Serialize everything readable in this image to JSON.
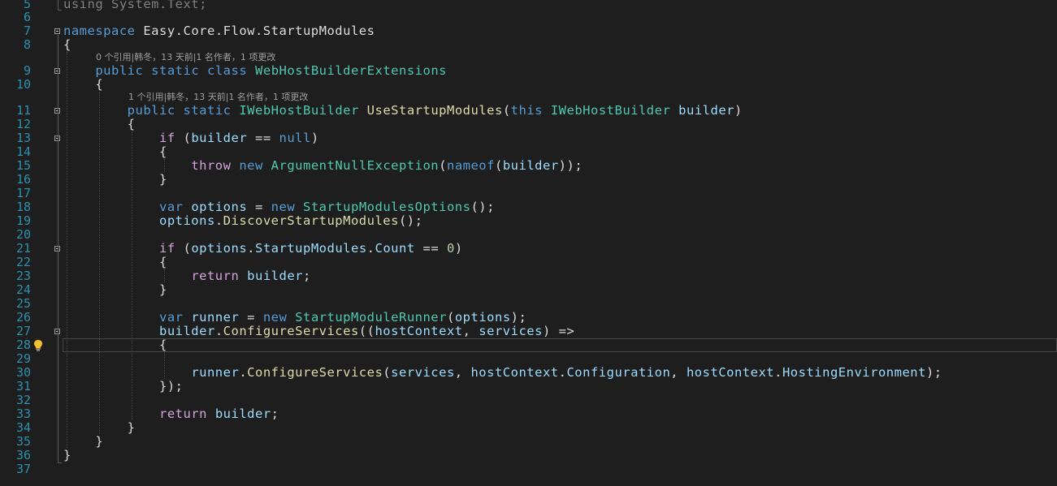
{
  "editor": {
    "line_numbers": [
      "5",
      "6",
      "7",
      "8",
      "9",
      "10",
      "11",
      "12",
      "13",
      "14",
      "15",
      "16",
      "17",
      "18",
      "19",
      "20",
      "21",
      "22",
      "23",
      "24",
      "25",
      "26",
      "27",
      "28",
      "29",
      "30",
      "31",
      "32",
      "33",
      "34",
      "35",
      "36",
      "37"
    ],
    "codelens": {
      "class_refs": "0 个引用|韩冬，13 天前|1 名作者，1 项更改",
      "method_refs": "1 个引用|韩冬，13 天前|1 名作者，1 项更改"
    },
    "code": {
      "l5": [
        {
          "t": "using System.Text;",
          "c": "dim"
        }
      ],
      "l7": [
        {
          "t": "namespace",
          "c": "kw"
        },
        {
          "t": " Easy.Core.Flow.StartupModules",
          "c": "pl"
        }
      ],
      "l8": [
        {
          "t": "{",
          "c": "pl"
        }
      ],
      "l9": [
        {
          "t": "    ",
          "c": "pl"
        },
        {
          "t": "public",
          "c": "kw"
        },
        {
          "t": " ",
          "c": "pl"
        },
        {
          "t": "static",
          "c": "kw"
        },
        {
          "t": " ",
          "c": "pl"
        },
        {
          "t": "class",
          "c": "kw"
        },
        {
          "t": " ",
          "c": "pl"
        },
        {
          "t": "WebHostBuilderExtensions",
          "c": "ty"
        }
      ],
      "l10": [
        {
          "t": "    {",
          "c": "pl"
        }
      ],
      "l11": [
        {
          "t": "        ",
          "c": "pl"
        },
        {
          "t": "public",
          "c": "kw"
        },
        {
          "t": " ",
          "c": "pl"
        },
        {
          "t": "static",
          "c": "kw"
        },
        {
          "t": " ",
          "c": "pl"
        },
        {
          "t": "IWebHostBuilder",
          "c": "ty"
        },
        {
          "t": " ",
          "c": "pl"
        },
        {
          "t": "UseStartupModules",
          "c": "fn"
        },
        {
          "t": "(",
          "c": "pl"
        },
        {
          "t": "this",
          "c": "kw"
        },
        {
          "t": " ",
          "c": "pl"
        },
        {
          "t": "IWebHostBuilder",
          "c": "ty"
        },
        {
          "t": " ",
          "c": "pl"
        },
        {
          "t": "builder",
          "c": "id"
        },
        {
          "t": ")",
          "c": "pl"
        }
      ],
      "l12": [
        {
          "t": "        {",
          "c": "pl"
        }
      ],
      "l13": [
        {
          "t": "            ",
          "c": "pl"
        },
        {
          "t": "if",
          "c": "ctl"
        },
        {
          "t": " (",
          "c": "pl"
        },
        {
          "t": "builder",
          "c": "id"
        },
        {
          "t": " == ",
          "c": "pl"
        },
        {
          "t": "null",
          "c": "kw"
        },
        {
          "t": ")",
          "c": "pl"
        }
      ],
      "l14": [
        {
          "t": "            {",
          "c": "pl"
        }
      ],
      "l15": [
        {
          "t": "                ",
          "c": "pl"
        },
        {
          "t": "throw",
          "c": "ctl"
        },
        {
          "t": " ",
          "c": "pl"
        },
        {
          "t": "new",
          "c": "kw"
        },
        {
          "t": " ",
          "c": "pl"
        },
        {
          "t": "ArgumentNullException",
          "c": "ty"
        },
        {
          "t": "(",
          "c": "pl"
        },
        {
          "t": "nameof",
          "c": "kw"
        },
        {
          "t": "(",
          "c": "pl"
        },
        {
          "t": "builder",
          "c": "id"
        },
        {
          "t": "));",
          "c": "pl"
        }
      ],
      "l16": [
        {
          "t": "            }",
          "c": "pl"
        }
      ],
      "l18": [
        {
          "t": "            ",
          "c": "pl"
        },
        {
          "t": "var",
          "c": "kw"
        },
        {
          "t": " ",
          "c": "pl"
        },
        {
          "t": "options",
          "c": "id"
        },
        {
          "t": " = ",
          "c": "pl"
        },
        {
          "t": "new",
          "c": "kw"
        },
        {
          "t": " ",
          "c": "pl"
        },
        {
          "t": "StartupModulesOptions",
          "c": "ty"
        },
        {
          "t": "();",
          "c": "pl"
        }
      ],
      "l19": [
        {
          "t": "            ",
          "c": "pl"
        },
        {
          "t": "options",
          "c": "id"
        },
        {
          "t": ".",
          "c": "pl"
        },
        {
          "t": "DiscoverStartupModules",
          "c": "fn"
        },
        {
          "t": "();",
          "c": "pl"
        }
      ],
      "l21": [
        {
          "t": "            ",
          "c": "pl"
        },
        {
          "t": "if",
          "c": "ctl"
        },
        {
          "t": " (",
          "c": "pl"
        },
        {
          "t": "options",
          "c": "id"
        },
        {
          "t": ".",
          "c": "pl"
        },
        {
          "t": "StartupModules",
          "c": "id"
        },
        {
          "t": ".",
          "c": "pl"
        },
        {
          "t": "Count",
          "c": "id"
        },
        {
          "t": " == ",
          "c": "pl"
        },
        {
          "t": "0",
          "c": "num"
        },
        {
          "t": ")",
          "c": "pl"
        }
      ],
      "l22": [
        {
          "t": "            {",
          "c": "pl"
        }
      ],
      "l23": [
        {
          "t": "                ",
          "c": "pl"
        },
        {
          "t": "return",
          "c": "ctl"
        },
        {
          "t": " ",
          "c": "pl"
        },
        {
          "t": "builder",
          "c": "id"
        },
        {
          "t": ";",
          "c": "pl"
        }
      ],
      "l24": [
        {
          "t": "            }",
          "c": "pl"
        }
      ],
      "l26": [
        {
          "t": "            ",
          "c": "pl"
        },
        {
          "t": "var",
          "c": "kw"
        },
        {
          "t": " ",
          "c": "pl"
        },
        {
          "t": "runner",
          "c": "id"
        },
        {
          "t": " = ",
          "c": "pl"
        },
        {
          "t": "new",
          "c": "kw"
        },
        {
          "t": " ",
          "c": "pl"
        },
        {
          "t": "StartupModuleRunner",
          "c": "ty"
        },
        {
          "t": "(",
          "c": "pl"
        },
        {
          "t": "options",
          "c": "id"
        },
        {
          "t": ");",
          "c": "pl"
        }
      ],
      "l27": [
        {
          "t": "            ",
          "c": "pl"
        },
        {
          "t": "builder",
          "c": "id"
        },
        {
          "t": ".",
          "c": "pl"
        },
        {
          "t": "ConfigureServices",
          "c": "fn"
        },
        {
          "t": "((",
          "c": "pl"
        },
        {
          "t": "hostContext",
          "c": "id"
        },
        {
          "t": ", ",
          "c": "pl"
        },
        {
          "t": "services",
          "c": "id"
        },
        {
          "t": ") =>",
          "c": "pl"
        }
      ],
      "l28": [
        {
          "t": "            {",
          "c": "pl"
        }
      ],
      "l30": [
        {
          "t": "                ",
          "c": "pl"
        },
        {
          "t": "runner",
          "c": "id"
        },
        {
          "t": ".",
          "c": "pl"
        },
        {
          "t": "ConfigureServices",
          "c": "fn"
        },
        {
          "t": "(",
          "c": "pl"
        },
        {
          "t": "services",
          "c": "id"
        },
        {
          "t": ", ",
          "c": "pl"
        },
        {
          "t": "hostContext",
          "c": "id"
        },
        {
          "t": ".",
          "c": "pl"
        },
        {
          "t": "Configuration",
          "c": "id"
        },
        {
          "t": ", ",
          "c": "pl"
        },
        {
          "t": "hostContext",
          "c": "id"
        },
        {
          "t": ".",
          "c": "pl"
        },
        {
          "t": "HostingEnvironment",
          "c": "id"
        },
        {
          "t": ");",
          "c": "pl"
        }
      ],
      "l31": [
        {
          "t": "            });",
          "c": "pl"
        }
      ],
      "l33": [
        {
          "t": "            ",
          "c": "pl"
        },
        {
          "t": "return",
          "c": "ctl"
        },
        {
          "t": " ",
          "c": "pl"
        },
        {
          "t": "builder",
          "c": "id"
        },
        {
          "t": ";",
          "c": "pl"
        }
      ],
      "l34": [
        {
          "t": "        }",
          "c": "pl"
        }
      ],
      "l35": [
        {
          "t": "    }",
          "c": "pl"
        }
      ],
      "l36": [
        {
          "t": "}",
          "c": "pl"
        }
      ]
    },
    "colors": {
      "background": "#1e1e1e",
      "line_number": "#2b91af",
      "keyword": "#569cd6",
      "control": "#d8a0df",
      "type": "#4ec9b0",
      "identifier": "#9cdcfe",
      "method": "#dcdcaa",
      "number": "#b5cea8",
      "plain": "#dcdcdc"
    },
    "icons": {
      "lightbulb": "lightbulb-icon",
      "fold": "collapse-toggle-icon"
    }
  }
}
